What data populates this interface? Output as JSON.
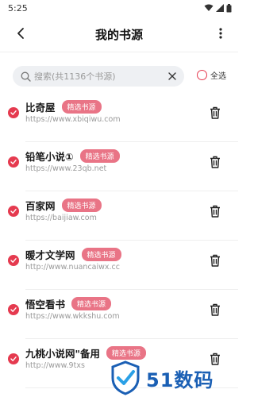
{
  "status_bar": {
    "time": "5:25"
  },
  "header": {
    "title": "我的书源"
  },
  "search": {
    "placeholder": "搜索(共1136个书源)",
    "select_all_label": "全选"
  },
  "list": {
    "items": [
      {
        "name": "比奇屋",
        "badge": "精选书源",
        "url": "https://www.xbiqiwu.com"
      },
      {
        "name": "铅笔小说①",
        "badge": "精选书源",
        "url": "https://www.23qb.net"
      },
      {
        "name": "百家网",
        "badge": "精选书源",
        "url": "https://baijiaw.com"
      },
      {
        "name": "暖才文学网",
        "badge": "精选书源",
        "url": "http://www.nuancaiwx.cc"
      },
      {
        "name": "悟空看书",
        "badge": "精选书源",
        "url": "https://www.wkkshu.com"
      },
      {
        "name": "九桃小说网\"备用",
        "badge": "精选书源",
        "url": "http://www.9txs"
      }
    ]
  },
  "watermark": {
    "text": "51数码"
  },
  "colors": {
    "accent": "#e53a4f",
    "badge": "#e97486",
    "watermark": "#1a5fb4"
  }
}
